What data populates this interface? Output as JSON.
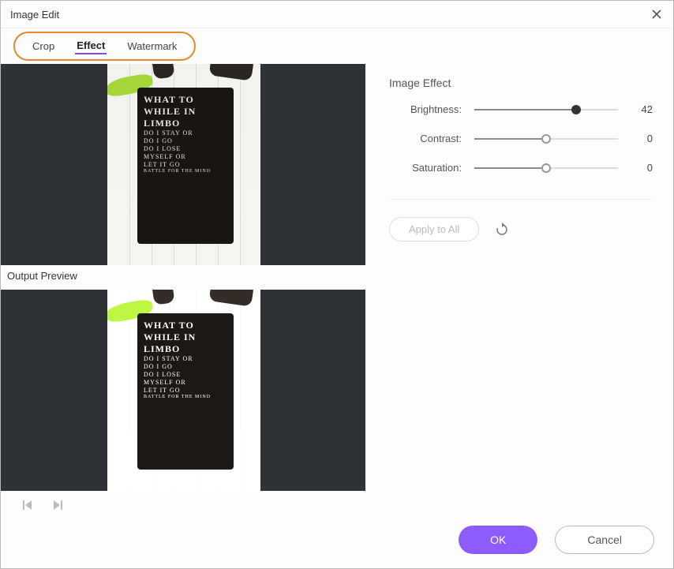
{
  "window": {
    "title": "Image Edit"
  },
  "tabs": {
    "crop": "Crop",
    "effect": "Effect",
    "watermark": "Watermark",
    "active": "effect"
  },
  "labels": {
    "output_preview": "Output Preview"
  },
  "panel": {
    "title": "Image Effect",
    "sliders": {
      "brightness": {
        "label": "Brightness:",
        "value": 42,
        "min": -100,
        "max": 100
      },
      "contrast": {
        "label": "Contrast:",
        "value": 0,
        "min": -100,
        "max": 100
      },
      "saturation": {
        "label": "Saturation:",
        "value": 0,
        "min": -100,
        "max": 100
      }
    },
    "apply_all": "Apply to All"
  },
  "footer": {
    "ok": "OK",
    "cancel": "Cancel"
  },
  "sample_text": {
    "l1": "WHAT TO",
    "l2": "WHILE IN",
    "l3": "LIMBO",
    "s1": "DO I STAY OR",
    "s2": "DO I GO",
    "s3": "DO I LOSE",
    "s4": "MYSELF OR",
    "s5": "LET IT GO",
    "t1": "BATTLE FOR THE MIND"
  }
}
